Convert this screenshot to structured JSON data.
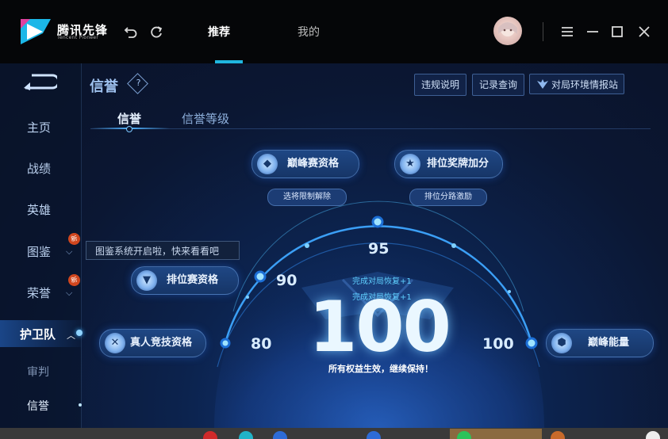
{
  "app": {
    "logo_text": "腾讯先锋",
    "logo_subtext": "Tencent Pioneer",
    "tabs": [
      {
        "label": "推荐",
        "active": true
      },
      {
        "label": "我的",
        "active": false
      }
    ],
    "icons": {
      "undo": "undo-icon",
      "refresh": "refresh-icon",
      "menu": "menu-icon",
      "minimize": "minimize-icon",
      "maximize": "maximize-icon",
      "close": "close-icon"
    },
    "accent_color": "#20b7e0"
  },
  "sidebar": {
    "items": [
      {
        "label": "主页"
      },
      {
        "label": "战绩"
      },
      {
        "label": "英雄"
      },
      {
        "label": "图鉴",
        "badge": "新"
      },
      {
        "label": "荣誉",
        "badge": "新"
      },
      {
        "label": "护卫队",
        "expanded": true
      },
      {
        "label": "审判"
      },
      {
        "label": "信誉",
        "selected": true
      }
    ]
  },
  "tooltip": {
    "text": "图鉴系统开启啦，快来看看吧"
  },
  "header": {
    "title": "信誉",
    "help": "?",
    "buttons": [
      {
        "label": "违规说明"
      },
      {
        "label": "记录查询"
      },
      {
        "label": "对局环境情报站"
      }
    ]
  },
  "subtabs": [
    {
      "label": "信誉",
      "active": true
    },
    {
      "label": "信誉等级",
      "active": false
    }
  ],
  "privileges": {
    "peak_qualification": {
      "label": "巅峰赛资格",
      "threshold": "100",
      "sub": "选将限制解除"
    },
    "rank_star_bonus": {
      "label": "排位奖牌加分",
      "threshold": "95",
      "sub": "排位分路激励"
    },
    "ranked_qualification": {
      "label": "排位赛资格",
      "threshold": "90"
    },
    "real_person_qualification": {
      "label": "真人竞技资格",
      "threshold": "80"
    },
    "peak_energy": {
      "label": "巅峰能量",
      "threshold": "100"
    }
  },
  "gauge": {
    "marks": [
      "80",
      "90",
      "95",
      "100"
    ],
    "score": "100",
    "recover_lines": [
      "完成对局恢复+1",
      "完成对局恢复+1"
    ],
    "status": "所有权益生效，继续保持！"
  }
}
